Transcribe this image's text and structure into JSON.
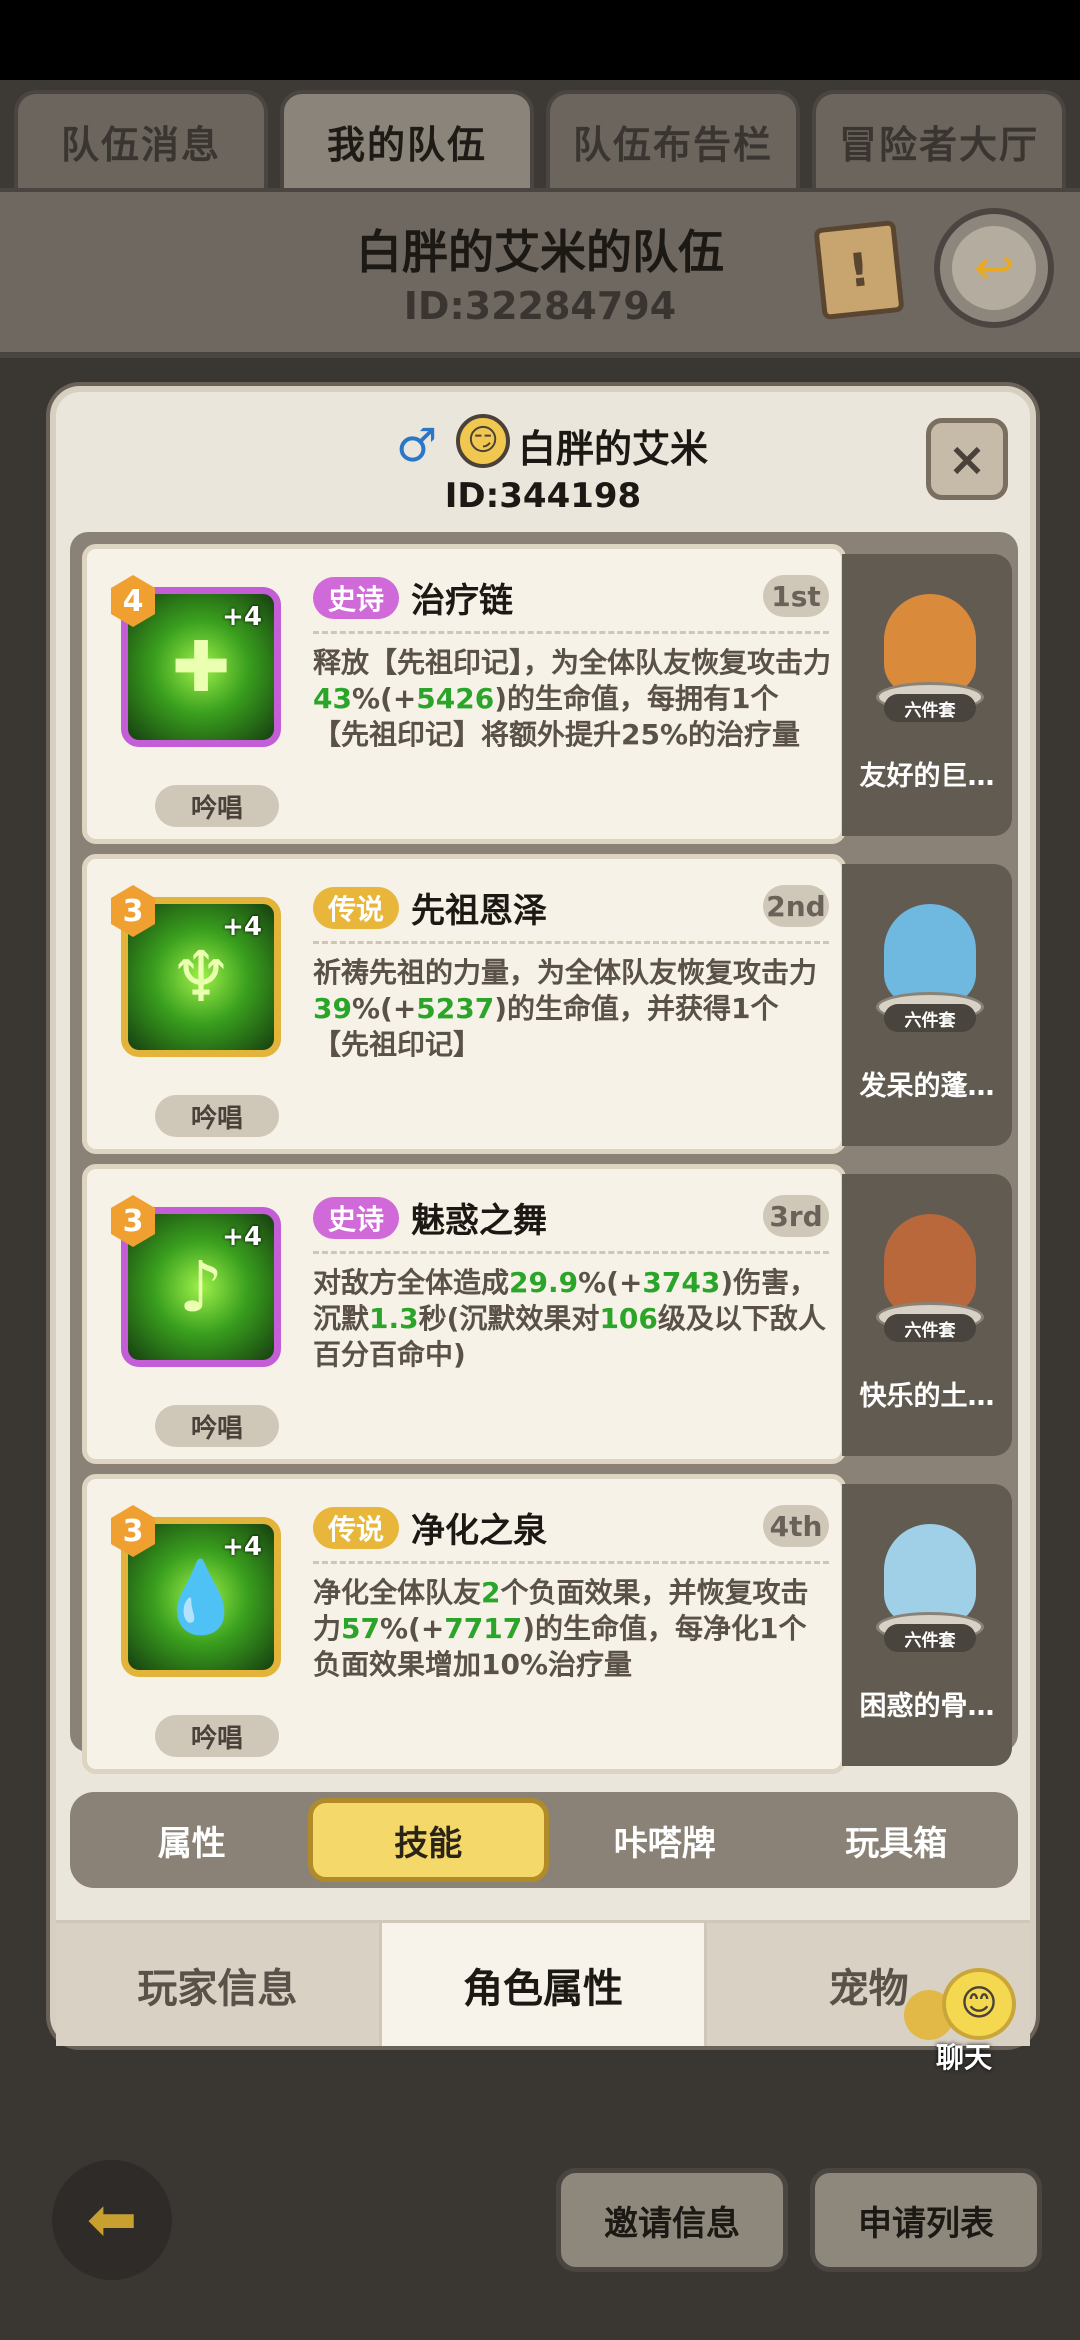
{
  "top_tabs": [
    "队伍消息",
    "我的队伍",
    "队伍布告栏",
    "冒险者大厅"
  ],
  "team": {
    "name": "白胖的艾米的队伍",
    "id": "ID:32284794"
  },
  "modal": {
    "player_name": "白胖的艾米",
    "player_id": "ID:344198",
    "close_glyph": "×",
    "gender_glyph": "♂"
  },
  "skills": [
    {
      "level": "4",
      "plus": "+4",
      "rarity": "史诗",
      "name": "治疗链",
      "order": "1st",
      "chant": "吟唱",
      "desc": [
        "释放【先祖印记】，为全体队友恢复攻击力",
        "43",
        "%(+",
        "5426",
        ")的生命值，每拥有1个【先祖印记】将额外提升25%的治疗量"
      ]
    },
    {
      "level": "3",
      "plus": "+4",
      "rarity": "传说",
      "name": "先祖恩泽",
      "order": "2nd",
      "chant": "吟唱",
      "desc": [
        "祈祷先祖的力量，为全体队友恢复攻击力",
        "39",
        "%(+",
        "5237",
        ")的生命值，并获得1个【先祖印记】"
      ]
    },
    {
      "level": "3",
      "plus": "+4",
      "rarity": "史诗",
      "name": "魅惑之舞",
      "order": "3rd",
      "chant": "吟唱",
      "desc": [
        "对敌方全体造成",
        "29.9",
        "%(+",
        "3743",
        ")伤害，沉默",
        "1.3",
        "秒(沉默效果对",
        "106",
        "级及以下敌人百分百命中)"
      ]
    },
    {
      "level": "3",
      "plus": "+4",
      "rarity": "传说",
      "name": "净化之泉",
      "order": "4th",
      "chant": "吟唱",
      "desc": [
        "净化全体队友",
        "2",
        "个负面效果，并恢复攻击力",
        "57",
        "%(+",
        "7717",
        ")的生命值，每净化1个负面效果增加10%治疗量"
      ]
    }
  ],
  "pets": [
    {
      "name": "友好的巨…",
      "set": "六件套"
    },
    {
      "name": "发呆的蓬…",
      "set": "六件套"
    },
    {
      "name": "快乐的土…",
      "set": "六件套"
    },
    {
      "name": "困惑的骨…",
      "set": "六件套"
    }
  ],
  "sub_tabs": [
    "属性",
    "技能",
    "咔嗒牌",
    "玩具箱"
  ],
  "bottom_tabs": [
    "玩家信息",
    "角色属性",
    "宠物"
  ],
  "chat": {
    "label": "聊天"
  },
  "footer": {
    "invite": "邀请信息",
    "apply": "申请列表"
  },
  "colors": {
    "highlight": "#2aa52a",
    "epic": "#d06ad8",
    "legend": "#e7b63a",
    "active_tab": "#f5d86a"
  }
}
